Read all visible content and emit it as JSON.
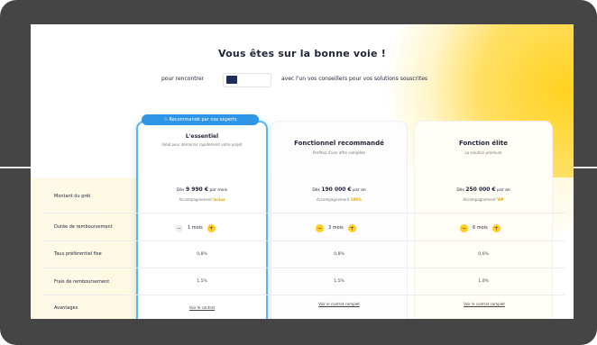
{
  "page": {
    "title": "Vous êtes sur la bonne voie !",
    "subtitle_left": "pour rencontrer",
    "subtitle_right": "avec l'un vos conseillers pour vos solutions souscrites",
    "badge": "Recommandé par nos experts"
  },
  "plans": [
    {
      "name": "L'essentiel",
      "description": "Idéal pour démarrer rapidement votre projet",
      "price_prefix": "Dès",
      "price": "9 990 €",
      "price_suffix": "par mois",
      "price_note_prefix": "Accompagnement",
      "price_note_value": "Inclus",
      "quantity": "1 mois",
      "cells": [
        "0,8%",
        "1,5%",
        "Voir le contrat"
      ]
    },
    {
      "name": "Fonctionnel recommandé",
      "description": "Profitez d'une offre complète",
      "price_prefix": "Dès",
      "price": "190 000 €",
      "price_suffix": "par an",
      "price_note_prefix": "Accompagnement",
      "price_note_value": "100%",
      "quantity": "3 mois",
      "cells": [
        "0,8%",
        "1,5%",
        "Voir le contrat complet"
      ]
    },
    {
      "name": "Fonction élite",
      "description": "La solution premium",
      "price_prefix": "Dès",
      "price": "250 000 €",
      "price_suffix": "par an",
      "price_note_prefix": "Accompagnement",
      "price_note_value": "VIP",
      "quantity": "6 mois",
      "cells": [
        "0,6%",
        "1,0%",
        "Voir le contrat complet"
      ]
    }
  ],
  "rows": [
    "Montant du prêt",
    "Durée de remboursement",
    "Taux préférentiel fixe",
    "Frais de remboursement",
    "Avantages"
  ]
}
